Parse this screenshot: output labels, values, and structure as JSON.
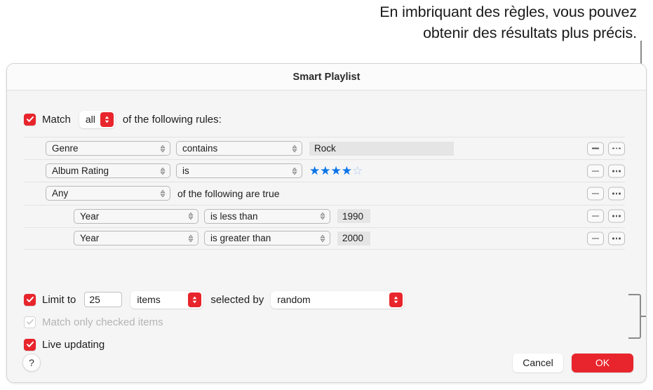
{
  "callout": {
    "line1": "En imbriquant des règles, vous pouvez",
    "line2": "obtenir des résultats plus précis."
  },
  "dialog": {
    "title": "Smart Playlist"
  },
  "match": {
    "checked": true,
    "label": "Match",
    "scope_value": "all",
    "suffix": "of the following rules:"
  },
  "rules": [
    {
      "indent": 1,
      "field": "Genre",
      "operator": "contains",
      "value_type": "text",
      "value": "Rock"
    },
    {
      "indent": 1,
      "field": "Album Rating",
      "operator": "is",
      "value_type": "rating",
      "rating_filled": 4,
      "rating_total": 5
    },
    {
      "indent": 1,
      "field": "Any",
      "value_type": "note",
      "note": "of the following are true"
    },
    {
      "indent": 2,
      "field": "Year",
      "operator": "is less than",
      "value_type": "number",
      "value": "1990"
    },
    {
      "indent": 2,
      "field": "Year",
      "operator": "is greater than",
      "value_type": "number",
      "value": "2000"
    }
  ],
  "row_buttons": {
    "remove_label": "remove-rule",
    "more_label": "more-options"
  },
  "options": {
    "limit_checked": true,
    "limit_label": "Limit to",
    "limit_count": "25",
    "limit_unit": "items",
    "selected_by_label": "selected by",
    "selected_by_value": "random",
    "match_checked_label": "Match only checked items",
    "match_checked_enabled": false,
    "live_updating_label": "Live updating",
    "live_updating_checked": true
  },
  "footer": {
    "help_label": "?",
    "cancel_label": "Cancel",
    "ok_label": "OK"
  },
  "colors": {
    "accent_red": "#e8252c",
    "star_blue": "#0a74e8",
    "star_empty": "#a8c9ef",
    "callout_gray": "#8a8a8a"
  }
}
